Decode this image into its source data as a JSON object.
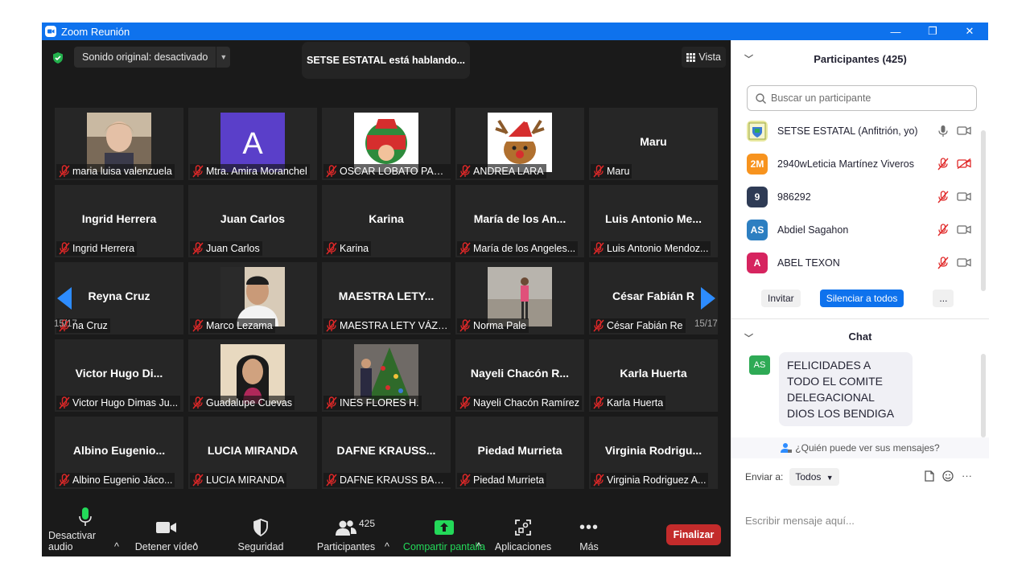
{
  "window": {
    "title": "Zoom Reunión",
    "minimize": "—",
    "restore": "❐",
    "close": "✕"
  },
  "stage": {
    "audio_label": "Sonido original: desactivado",
    "speaking_label": "SETSE ESTATAL está hablando...",
    "view_label": "Vista",
    "page_left": "15/17",
    "page_right": "15/17"
  },
  "tiles": [
    {
      "big": "",
      "name": "maria luisa valenzuela",
      "photo": "webcam-woman"
    },
    {
      "big": "",
      "name": "Mtra. Amira Moranchel",
      "photo": "letter-a"
    },
    {
      "big": "",
      "name": "OSCAR LOBATO PALA...",
      "photo": "maestro-oscar-logo"
    },
    {
      "big": "",
      "name": "ANDREA LARA",
      "photo": "reindeer"
    },
    {
      "big": "Maru",
      "name": "Maru",
      "photo": ""
    },
    {
      "big": "Ingrid Herrera",
      "name": "Ingrid Herrera",
      "photo": ""
    },
    {
      "big": "Juan Carlos",
      "name": "Juan Carlos",
      "photo": ""
    },
    {
      "big": "Karina",
      "name": "Karina",
      "photo": ""
    },
    {
      "big": "María de los An...",
      "name": "María de los Angeles...",
      "photo": ""
    },
    {
      "big": "Luis Antonio Me...",
      "name": "Luis Antonio Mendoz...",
      "photo": ""
    },
    {
      "big": "Reyna Cruz",
      "name": "na Cruz",
      "photo": ""
    },
    {
      "big": "",
      "name": "Marco Lezama",
      "photo": "man-portrait"
    },
    {
      "big": "MAESTRA LETY...",
      "name": "MAESTRA LETY VÁZQ...",
      "photo": ""
    },
    {
      "big": "",
      "name": "Norma Pale",
      "photo": "beach-woman"
    },
    {
      "big": "César Fabián R",
      "name": "César Fabián Re",
      "photo": ""
    },
    {
      "big": "Victor Hugo Di...",
      "name": "Victor Hugo Dimas Ju...",
      "photo": ""
    },
    {
      "big": "",
      "name": "Guadalupe Cuevas",
      "photo": "woman-portrait"
    },
    {
      "big": "",
      "name": "INES FLORES H.",
      "photo": "christmas-tree"
    },
    {
      "big": "Nayeli Chacón R...",
      "name": "Nayeli Chacón Ramírez",
      "photo": ""
    },
    {
      "big": "Karla Huerta",
      "name": "Karla Huerta",
      "photo": ""
    },
    {
      "big": "Albino Eugenio...",
      "name": "Albino Eugenio Jáco...",
      "photo": ""
    },
    {
      "big": "LUCIA MIRANDA",
      "name": "LUCIA MIRANDA",
      "photo": ""
    },
    {
      "big": "DAFNE KRAUSS...",
      "name": "DAFNE KRAUSS BAN...",
      "photo": ""
    },
    {
      "big": "Piedad Murrieta",
      "name": "Piedad Murrieta",
      "photo": ""
    },
    {
      "big": "Virginia Rodrigu...",
      "name": "Virginia Rodriguez A...",
      "photo": ""
    }
  ],
  "toolbar": {
    "mute": "Desactivar audio",
    "video": "Detener vídeo",
    "security": "Seguridad",
    "participants": "Participantes",
    "participants_count": "425",
    "share": "Compartir pantalla",
    "apps": "Aplicaciones",
    "more": "Más",
    "end": "Finalizar"
  },
  "panel": {
    "participants_title": "Participantes (425)",
    "search_placeholder": "Buscar un participante",
    "participants": [
      {
        "initials": "",
        "name": "SETSE ESTATAL (Anfitrión, yo)",
        "color": "#e8e8a0",
        "muted": false,
        "video_off": false
      },
      {
        "initials": "2M",
        "name": "2940wLeticia Martínez Viveros",
        "color": "#f7931e",
        "muted": true,
        "video_off": true
      },
      {
        "initials": "9",
        "name": "986292",
        "color": "#2e3b55",
        "muted": true,
        "video_off": false
      },
      {
        "initials": "AS",
        "name": "Abdiel Sagahon",
        "color": "#2d7fc1",
        "muted": true,
        "video_off": false
      },
      {
        "initials": "A",
        "name": "ABEL TEXON",
        "color": "#d6245f",
        "muted": true,
        "video_off": false
      }
    ],
    "invite": "Invitar",
    "mute_all": "Silenciar a todos",
    "more": "...",
    "chat_title": "Chat",
    "chat_message": {
      "initials": "AS",
      "text": "FELICIDADES A TODO EL COMITE DELEGACIONAL DIOS LOS BENDIGA"
    },
    "who_can_see": "¿Quién puede ver sus mensajes?",
    "send_to_label": "Enviar a:",
    "send_to_value": "Todos",
    "compose_placeholder": "Escribir mensaje aquí..."
  },
  "colors": {
    "accent": "#0e72ed",
    "end_red": "#c32b2b",
    "share_green": "#23d959",
    "mic_green": "#23d959",
    "muted_red": "#e02828"
  }
}
